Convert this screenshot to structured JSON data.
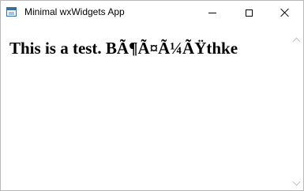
{
  "window": {
    "title": "Minimal wxWidgets App",
    "icon": "app-window-icon",
    "controls": {
      "minimize_icon": "minimize-icon",
      "maximize_icon": "maximize-icon",
      "close_icon": "close-icon"
    }
  },
  "content": {
    "text": "This is a test. BÃ¶Ã¤Ã¼ÃŸthke"
  },
  "scrollbar": {
    "up_icon": "chevron-up-icon",
    "down_icon": "chevron-down-icon"
  }
}
